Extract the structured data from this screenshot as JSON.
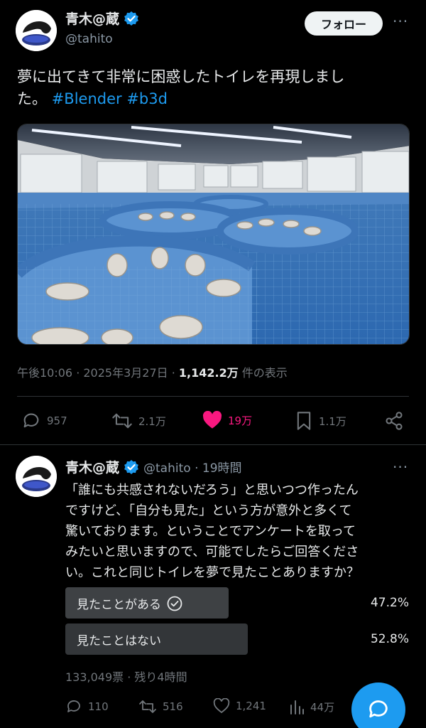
{
  "main_tweet": {
    "display_name": "青木@蔵",
    "handle": "@tahito",
    "follow_label": "フォロー",
    "more_label": "···",
    "text_line1": "夢に出てきて非常に困惑したトイレを再現しまし",
    "text_line2_prefix": "た。",
    "hashtags": [
      "#Blender",
      "#b3d"
    ],
    "time": "午後10:06 · 2025年3月27日 · ",
    "views_count": "1,142.2万",
    "views_label": " 件の表示",
    "replies": "957",
    "retweets": "2.1万",
    "likes": "19万",
    "bookmarks": "1.1万"
  },
  "reply_tweet": {
    "display_name": "青木@蔵",
    "handle_time": "@tahito · 19時間",
    "text_lines": [
      "「誰にも共感されないだろう」と思いつつ作ったん",
      "ですけど、「自分も見た」という方が意外と多くて",
      "驚いております。ということでアンケートを取って",
      "みたいと思いますので、可能でしたらご回答くださ",
      "い。これと同じトイレを夢で見たことありますか？"
    ],
    "poll": {
      "options": [
        {
          "label": "見たことがある",
          "percent": "47.2%",
          "fraction": 0.472,
          "selected": true
        },
        {
          "label": "見たことはない",
          "percent": "52.8%",
          "fraction": 0.528,
          "selected": false
        }
      ],
      "summary": "133,049票 · 残り4時間"
    },
    "replies": "110",
    "retweets": "516",
    "likes": "1,241",
    "views": "44万"
  },
  "colors": {
    "accent": "#1d9bf0",
    "like": "#f91880",
    "muted": "#71767b"
  }
}
